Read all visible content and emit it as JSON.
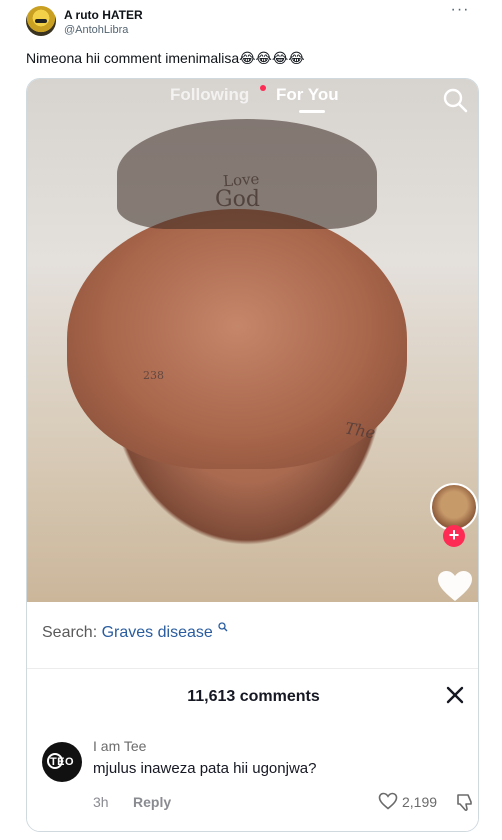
{
  "tweet": {
    "display_name": "A ruto HATER",
    "handle": "@AntohLibra",
    "text": "Nimeona hii comment imenimalisa😂😂😂😂",
    "more_label": "···"
  },
  "video": {
    "tabs": [
      "Following",
      "For You"
    ],
    "active_tab": "For You",
    "tattoo_texts": [
      "Love",
      "God",
      "238",
      "The"
    ]
  },
  "comments_panel": {
    "search_label": "Search:",
    "search_term": "Graves disease",
    "count_label": "11,613 comments",
    "comments": [
      {
        "username": "I am Tee",
        "avatar_text": "TEO",
        "text": "mjulus inaweza pata hii ugonjwa?",
        "time": "3h",
        "reply_label": "Reply",
        "likes": "2,199"
      }
    ]
  },
  "colors": {
    "tiktok_red": "#fe2c55",
    "search_blue": "#2a5d9f",
    "handle_gray": "#536471"
  }
}
